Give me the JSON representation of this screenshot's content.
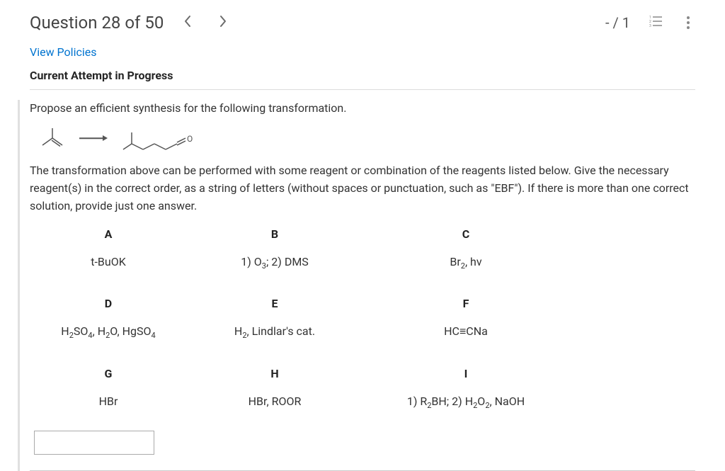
{
  "header": {
    "title": "Question 28 of 50",
    "attempt_counter": "- / 1"
  },
  "links": {
    "view_policies": "View Policies"
  },
  "status": {
    "current_attempt": "Current Attempt in Progress"
  },
  "question": {
    "prompt": "Propose an efficient synthesis for the following transformation.",
    "instruction": "The transformation above can be performed with some reagent or combination of the reagents listed below. Give the necessary reagent(s) in the correct order, as a string of letters (without spaces or punctuation, such as \"EBF\"). If there is more than one correct solution, provide just one answer."
  },
  "reagents": {
    "A": {
      "letter": "A",
      "formula": "t-BuOK"
    },
    "B": {
      "letter": "B",
      "formula_parts": [
        "1) O",
        "3",
        "; 2) DMS"
      ]
    },
    "C": {
      "letter": "C",
      "formula_parts": [
        "Br",
        "2",
        ", hv"
      ]
    },
    "D": {
      "letter": "D",
      "formula_parts": [
        "H",
        "2",
        "SO",
        "4",
        ", H",
        "2",
        "O, HgSO",
        "4"
      ]
    },
    "E": {
      "letter": "E",
      "formula_parts": [
        "H",
        "2",
        ", Lindlar's cat."
      ]
    },
    "F": {
      "letter": "F",
      "formula": "HC≡CNa"
    },
    "G": {
      "letter": "G",
      "formula": "HBr"
    },
    "H": {
      "letter": "H",
      "formula": "HBr, ROOR"
    },
    "I": {
      "letter": "I",
      "formula_parts": [
        "1) R",
        "2",
        "BH; 2) H",
        "2",
        "O",
        "2",
        ", NaOH"
      ]
    }
  },
  "answer": {
    "value": ""
  }
}
